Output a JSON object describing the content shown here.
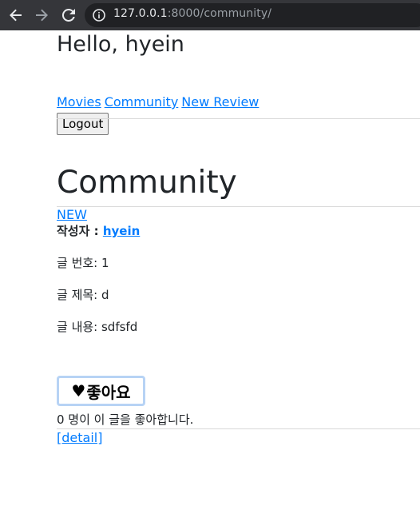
{
  "browser": {
    "url_host": "127.0.0.1",
    "url_rest": ":8000/community/"
  },
  "header": {
    "greeting": "Hello, hyein",
    "nav": [
      "Movies",
      "Community",
      "New Review"
    ],
    "logout_label": "Logout"
  },
  "main": {
    "title": "Community",
    "new_link": "NEW"
  },
  "post": {
    "author_label": "작성자 : ",
    "author": "hyein",
    "number_label": "글 번호: 1",
    "title_label": "글 제목: d",
    "content_label": "글 내용: sdfsfd",
    "like_heart": "♥",
    "like_label": "좋아요",
    "like_count_text": "0 명이 이 글을 좋아합니다.",
    "detail_link": "[detail]"
  },
  "colors": {
    "link": "#007bff",
    "toolbar": "#35363a",
    "like_border": "#b7d3f5"
  }
}
